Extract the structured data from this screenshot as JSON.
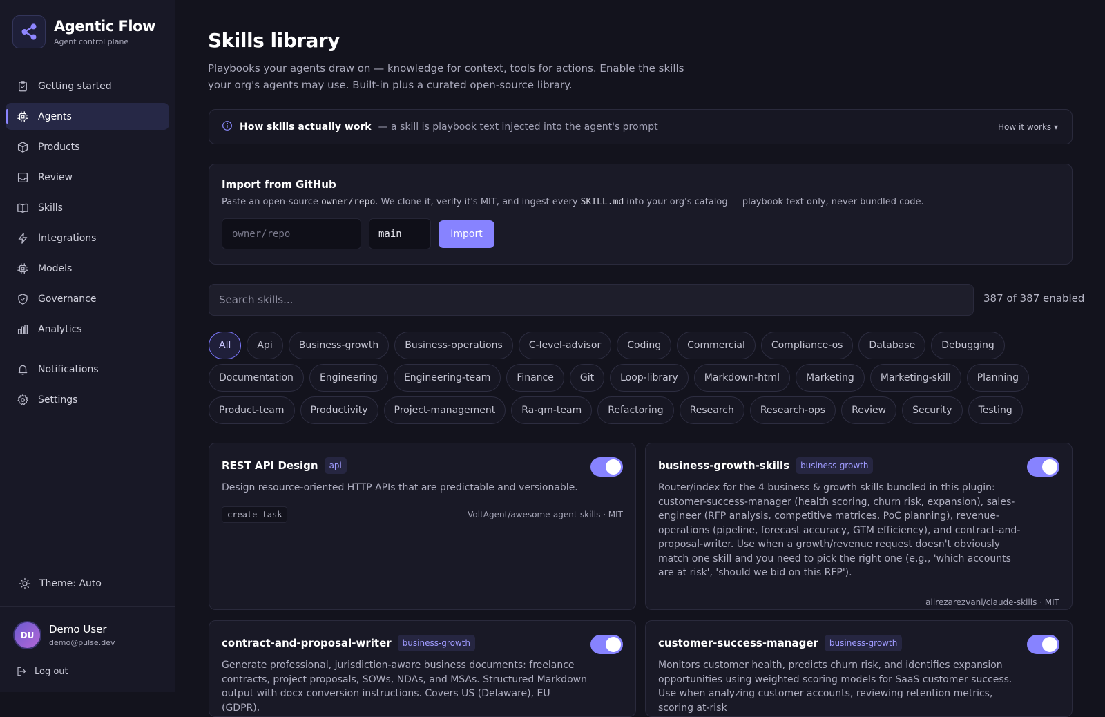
{
  "brand": {
    "title": "Agentic Flow",
    "subtitle": "Agent control plane"
  },
  "sidebar": {
    "items": [
      {
        "label": "Getting started",
        "icon": "clipboard-check-icon"
      },
      {
        "label": "Agents",
        "icon": "cpu-chip-icon",
        "active": true
      },
      {
        "label": "Products",
        "icon": "package-icon"
      },
      {
        "label": "Review",
        "icon": "inbox-icon"
      },
      {
        "label": "Skills",
        "icon": "book-open-icon"
      },
      {
        "label": "Integrations",
        "icon": "lightning-icon"
      },
      {
        "label": "Models",
        "icon": "chip-icon"
      },
      {
        "label": "Governance",
        "icon": "shield-check-icon"
      },
      {
        "label": "Analytics",
        "icon": "bar-chart-icon"
      }
    ],
    "secondary": [
      {
        "label": "Notifications",
        "icon": "bell-icon"
      },
      {
        "label": "Settings",
        "icon": "gear-icon"
      }
    ],
    "theme_label": "Theme: Auto",
    "user": {
      "initials": "DU",
      "name": "Demo User",
      "email": "demo@pulse.dev"
    },
    "logout_label": "Log out"
  },
  "page": {
    "title": "Skills library",
    "description": "Playbooks your agents draw on — knowledge for context, tools for actions. Enable the skills your org's agents may use. Built-in plus a curated open-source library."
  },
  "info_bar": {
    "title": "How skills actually work",
    "text": "— a skill is playbook text injected into the agent's prompt",
    "link": "How it works ▾"
  },
  "import": {
    "title": "Import from GitHub",
    "desc_before": "Paste an open-source ",
    "desc_code1": "owner/repo",
    "desc_mid": ". We clone it, verify it's MIT, and ingest every ",
    "desc_code2": "SKILL.md",
    "desc_after": " into your org's catalog — playbook text only, never bundled code.",
    "repo_placeholder": "owner/repo",
    "branch_value": "main",
    "button_label": "Import"
  },
  "search": {
    "placeholder": "Search skills...",
    "enabled_count": "387 of 387 enabled"
  },
  "categories": [
    [
      "All",
      "Api",
      "Business-growth",
      "Business-operations",
      "C-level-advisor",
      "Coding",
      "Commercial",
      "Compliance-os",
      "Database",
      "Debugging"
    ],
    [
      "Documentation",
      "Engineering",
      "Engineering-team",
      "Finance",
      "Git",
      "Loop-library",
      "Markdown-html",
      "Marketing",
      "Marketing-skill",
      "Planning"
    ],
    [
      "Product-team",
      "Productivity",
      "Project-management",
      "Ra-qm-team",
      "Refactoring",
      "Research",
      "Research-ops",
      "Review",
      "Security",
      "Testing"
    ]
  ],
  "skills": [
    {
      "title": "REST API Design",
      "tag": "api",
      "desc": "Design resource-oriented HTTP APIs that are predictable and versionable.",
      "tool": "create_task",
      "source": "VoltAgent/awesome-agent-skills · MIT",
      "enabled": true
    },
    {
      "title": "business-growth-skills",
      "tag": "business-growth",
      "desc": "Router/index for the 4 business & growth skills bundled in this plugin: customer-success-manager (health scoring, churn risk, expansion), sales-engineer (RFP analysis, competitive matrices, PoC planning), revenue-operations (pipeline, forecast accuracy, GTM efficiency), and contract-and-proposal-writer. Use when a growth/revenue request doesn't obviously match one skill and you need to pick the right one (e.g., 'which accounts are at risk', 'should we bid on this RFP').",
      "source": "alirezarezvani/claude-skills · MIT",
      "enabled": true
    },
    {
      "title": "contract-and-proposal-writer",
      "tag": "business-growth",
      "desc": "Generate professional, jurisdiction-aware business documents: freelance contracts, project proposals, SOWs, NDAs, and MSAs. Structured Markdown output with docx conversion instructions. Covers US (Delaware), EU (GDPR),",
      "enabled": true
    },
    {
      "title": "customer-success-manager",
      "tag": "business-growth",
      "desc": "Monitors customer health, predicts churn risk, and identifies expansion opportunities using weighted scoring models for SaaS customer success. Use when analyzing customer accounts, reviewing retention metrics, scoring at-risk",
      "enabled": true
    }
  ]
}
